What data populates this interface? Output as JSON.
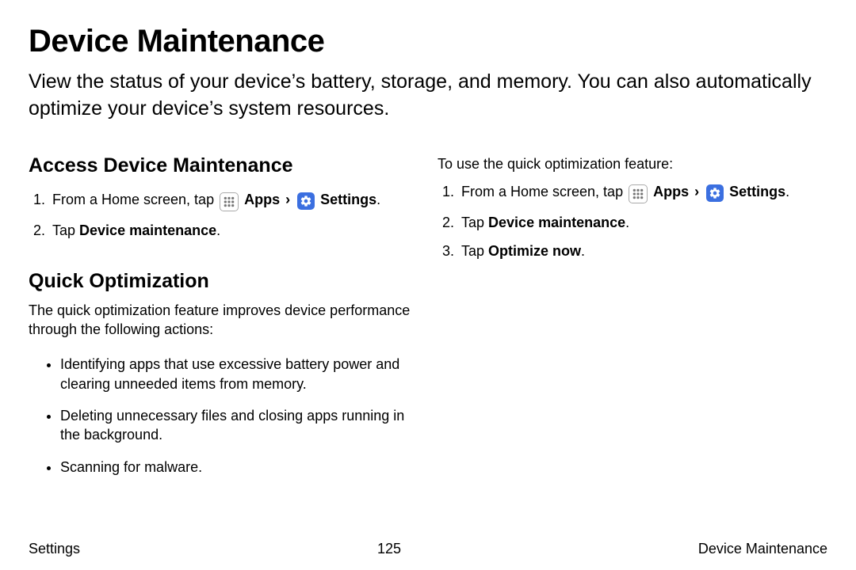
{
  "title": "Device Maintenance",
  "intro": "View the status of your device’s battery, storage, and memory. You can also automatically optimize your device’s system resources.",
  "sections": {
    "access": {
      "heading": "Access Device Maintenance",
      "step1_prefix": "From a Home screen, tap ",
      "apps_label": "Apps",
      "settings_label": "Settings",
      "step2_prefix": "Tap ",
      "step2_bold": "Device maintenance",
      "period": "."
    },
    "quick": {
      "heading": "Quick Optimization",
      "lead": "The quick optimization feature improves device performance through the following actions:",
      "bullets": [
        "Identifying apps that use excessive battery power and clearing unneeded items from memory.",
        "Deleting unnecessary files and closing apps running in the background.",
        "Scanning for malware."
      ]
    },
    "use": {
      "lead": "To use the quick optimization feature:",
      "step1_prefix": "From a Home screen, tap ",
      "apps_label": "Apps",
      "settings_label": "Settings",
      "step2_prefix": "Tap ",
      "step2_bold": "Device maintenance",
      "step3_prefix": "Tap ",
      "step3_bold": "Optimize now",
      "period": "."
    }
  },
  "footer": {
    "left": "Settings",
    "center": "125",
    "right": "Device Maintenance"
  },
  "chevron": "›"
}
